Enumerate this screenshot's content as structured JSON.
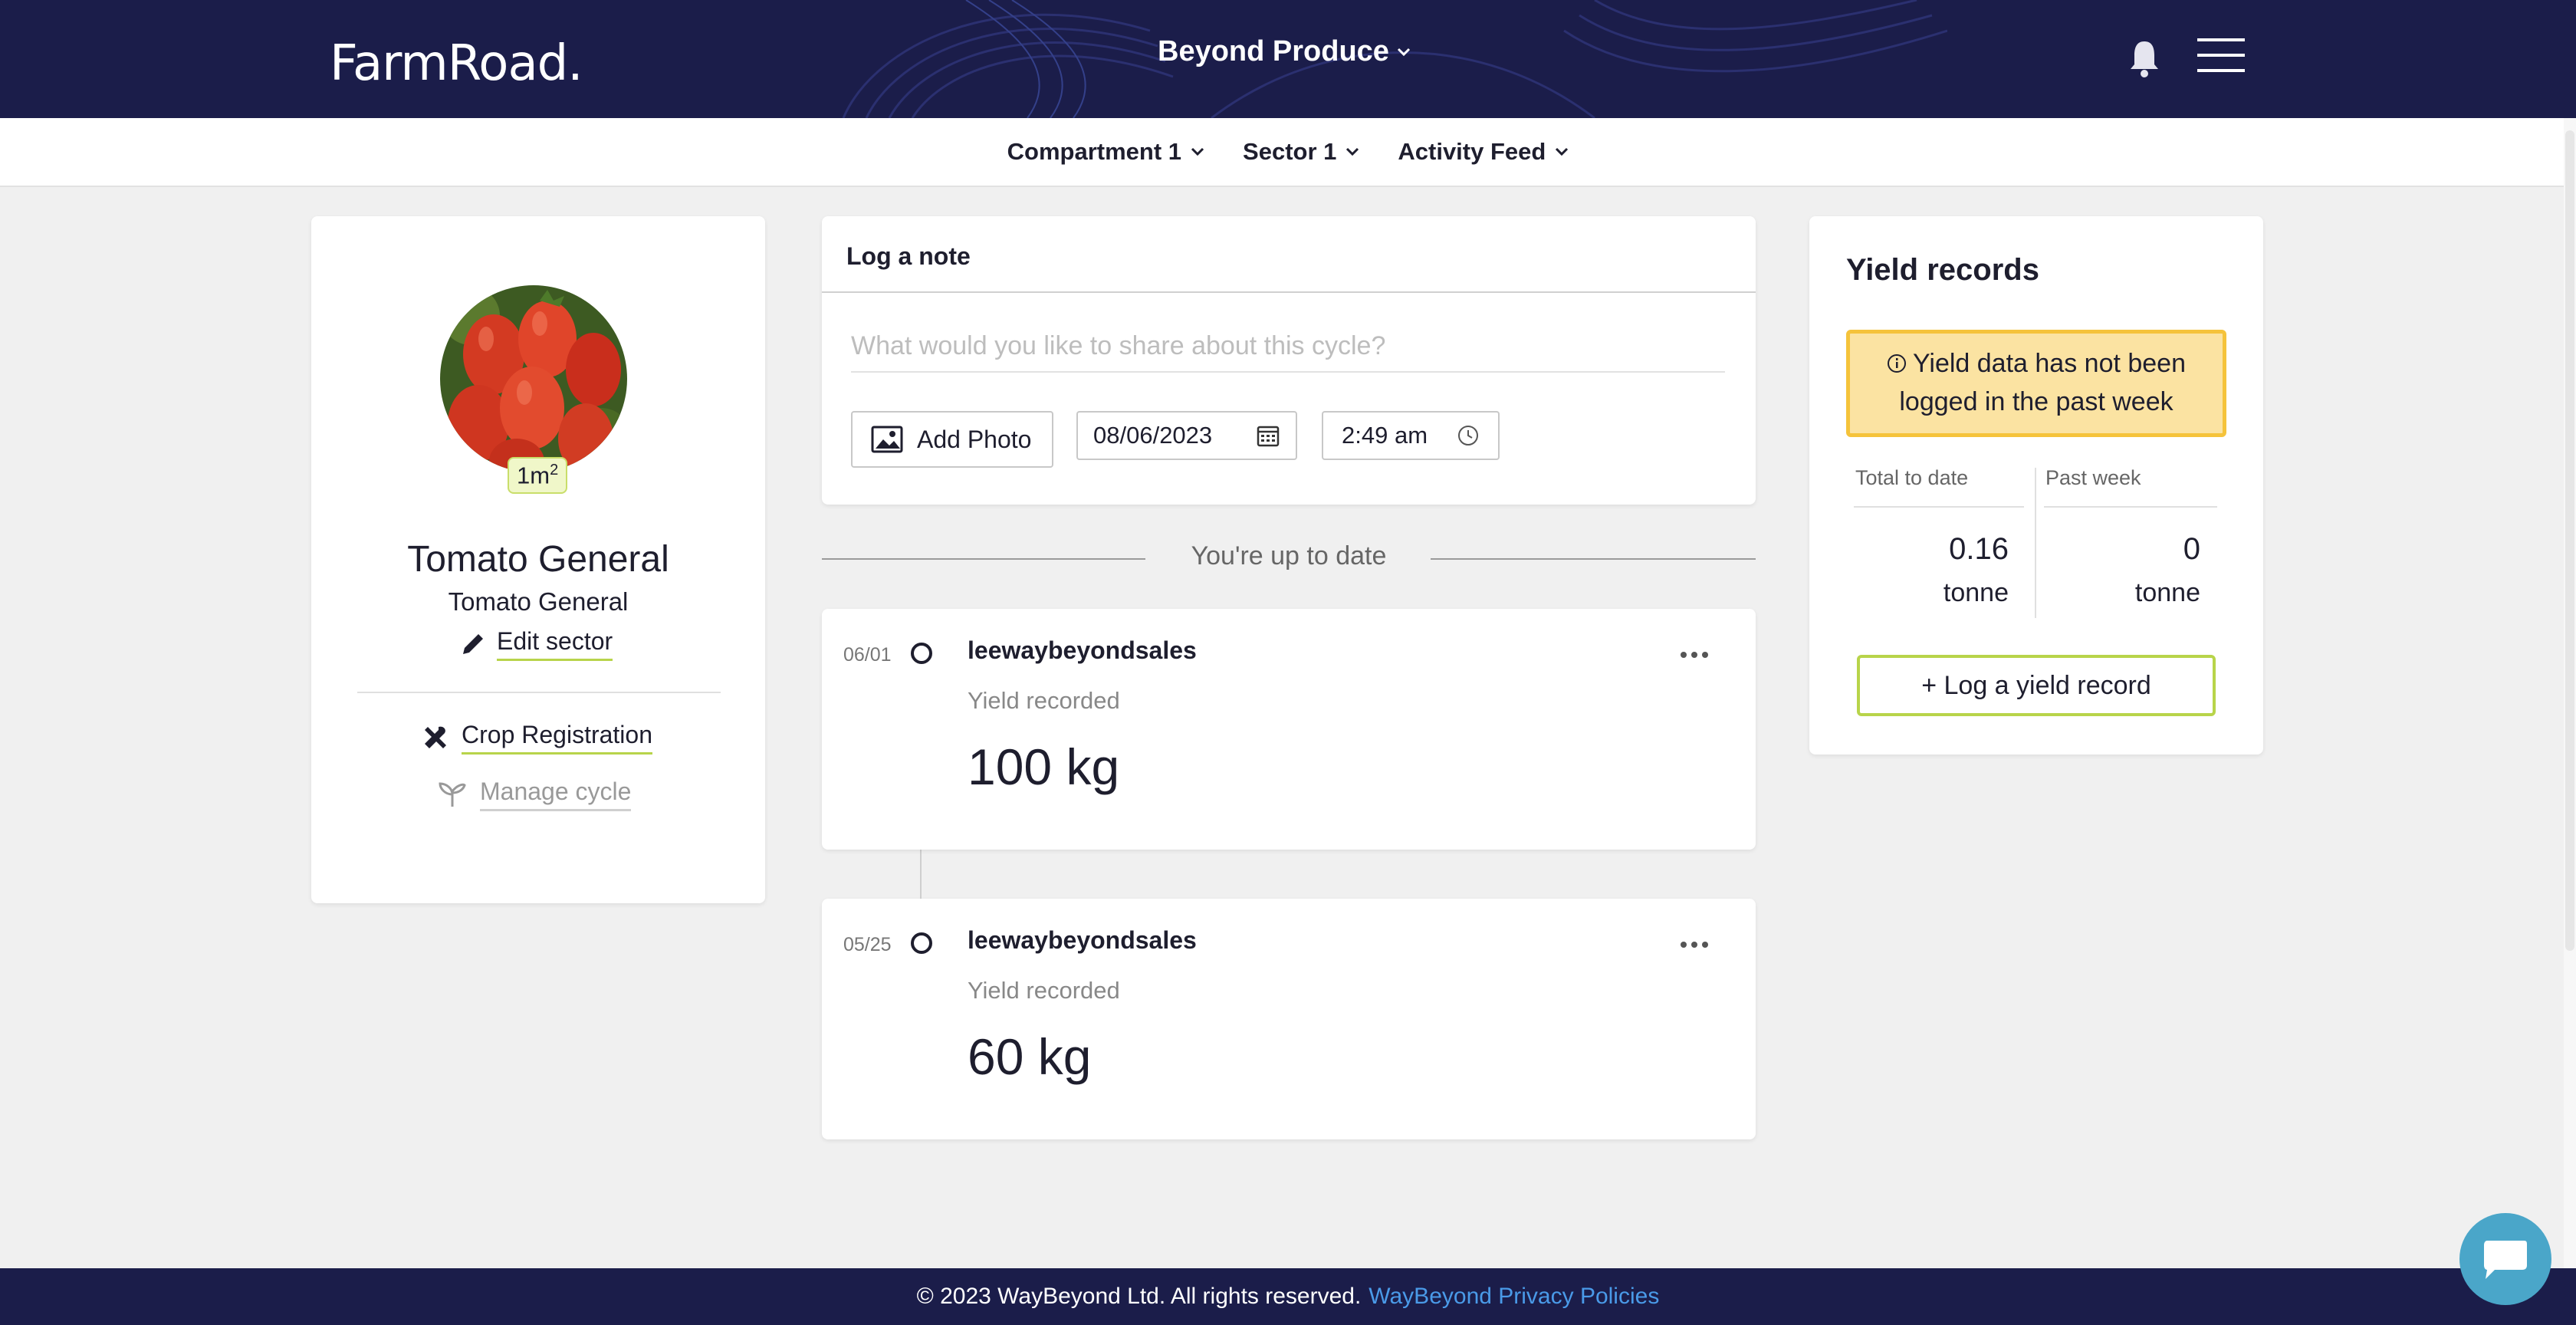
{
  "header": {
    "logo": "FarmRoad.",
    "organization": "Beyond Produce"
  },
  "subnav": {
    "compartment": "Compartment 1",
    "sector": "Sector 1",
    "activity": "Activity Feed"
  },
  "sector_card": {
    "area": "1m",
    "area_sup": "2",
    "crop_name": "Tomato General",
    "crop_variety": "Tomato General",
    "edit_label": "Edit sector",
    "crop_registration": "Crop Registration",
    "manage_cycle": "Manage cycle"
  },
  "note": {
    "title": "Log a note",
    "placeholder": "What would you like to share about this cycle?",
    "add_photo": "Add Photo",
    "date": "08/06/2023",
    "time": "2:49 am"
  },
  "feed": {
    "status": "You're up to date",
    "entries": [
      {
        "date": "06/01",
        "user": "leewaybeyondsales",
        "type": "Yield recorded",
        "amount": "100 kg"
      },
      {
        "date": "05/25",
        "user": "leewaybeyondsales",
        "type": "Yield recorded",
        "amount": "60 kg"
      }
    ]
  },
  "yield": {
    "title": "Yield records",
    "alert": "Yield data has not been logged in the past week",
    "total_label": "Total to date",
    "total_value": "0.16",
    "total_unit": "tonne",
    "week_label": "Past week",
    "week_value": "0",
    "week_unit": "tonne",
    "log_button": "+ Log a yield record"
  },
  "footer": {
    "copyright": "© 2023 WayBeyond Ltd. All rights reserved.",
    "privacy_link": "WayBeyond Privacy Policies"
  },
  "colors": {
    "navy": "#1b1d4a",
    "accent_green": "#b8d44a",
    "alert_bg": "#fbe3a2",
    "alert_border": "#f5c33b",
    "link_blue": "#4a9ae8",
    "chat": "#4aa6c9"
  }
}
